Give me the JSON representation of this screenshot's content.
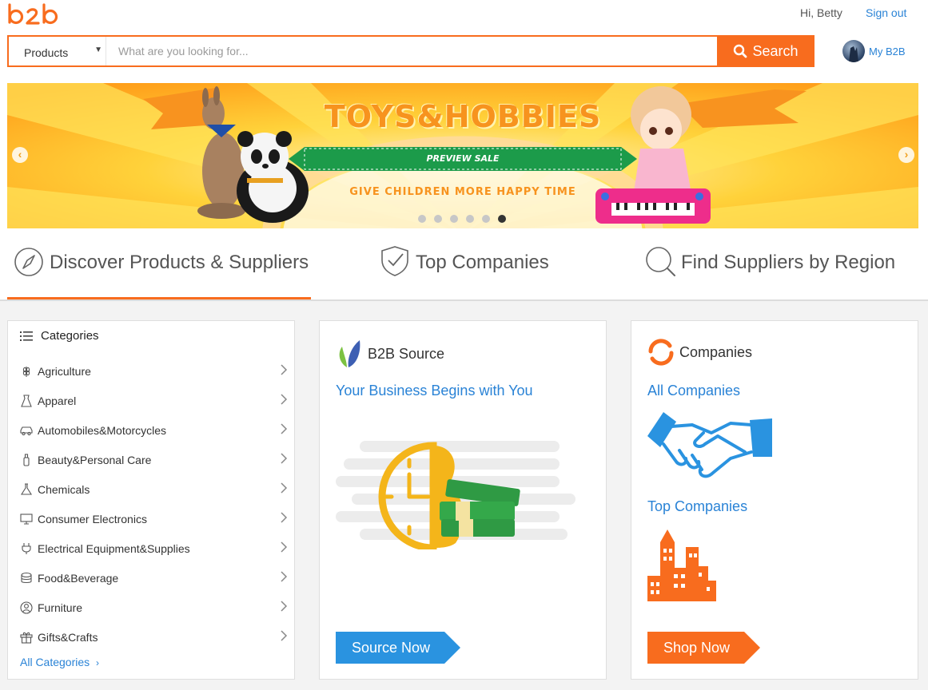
{
  "header": {
    "greeting": "Hi, Betty",
    "sign_out": "Sign out",
    "my_b2b": "My B2B",
    "brand_color": "#f86c1e",
    "link_color": "#2a83d6"
  },
  "search": {
    "category": "Products",
    "placeholder": "What are you looking for...",
    "value": "",
    "button": "Search",
    "icon": "search-icon"
  },
  "banner": {
    "title": "TOYS&HOBBIES",
    "ribbon": "PREVIEW SALE",
    "subtitle": "GIVE CHILDREN MORE HAPPY TIME",
    "slide_count": 6,
    "active_slide": 6
  },
  "tabs": [
    {
      "label": "Discover Products & Suppliers",
      "icon": "compass-icon",
      "active": true
    },
    {
      "label": "Top Companies",
      "icon": "shield-check-icon",
      "active": false
    },
    {
      "label": "Find Suppliers by Region",
      "icon": "magnifier-icon",
      "active": false
    }
  ],
  "categories": {
    "title": "Categories",
    "items": [
      {
        "label": "Agriculture",
        "icon": "wheat-icon"
      },
      {
        "label": "Apparel",
        "icon": "dress-icon"
      },
      {
        "label": "Automobiles&Motorcycles",
        "icon": "car-icon"
      },
      {
        "label": "Beauty&Personal Care",
        "icon": "bottle-icon"
      },
      {
        "label": "Chemicals",
        "icon": "flask-icon"
      },
      {
        "label": "Consumer Electronics",
        "icon": "monitor-icon"
      },
      {
        "label": "Electrical Equipment&Supplies",
        "icon": "plug-icon"
      },
      {
        "label": "Food&Beverage",
        "icon": "food-icon"
      },
      {
        "label": "Furniture",
        "icon": "chair-icon"
      },
      {
        "label": "Gifts&Crafts",
        "icon": "gift-icon"
      }
    ],
    "all_label": "All Categories",
    "all_suffix": "›"
  },
  "source_card": {
    "title": "B2B Source",
    "link": "Your Business Begins with You",
    "cta": "Source Now",
    "cta_color": "#2a93e0"
  },
  "companies_card": {
    "title": "Companies",
    "link_all": "All Companies",
    "link_top": "Top Companies",
    "cta": "Shop Now",
    "cta_color": "#f86c1e"
  }
}
